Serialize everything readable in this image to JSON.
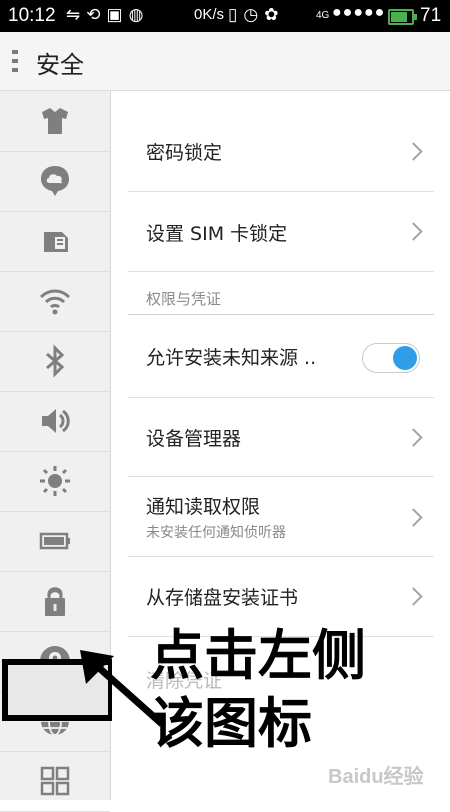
{
  "status_bar": {
    "time": "10:12",
    "speed": "0K/s",
    "network": "4G",
    "battery_level": "71",
    "icons": [
      "usb-icon",
      "sync-icon",
      "image-icon",
      "weibo-icon",
      "vibrate-icon",
      "alarm-icon",
      "paw-icon",
      "signal-icon",
      "battery-icon"
    ]
  },
  "title_bar": {
    "title": "安全",
    "menu_icon": "menu-icon"
  },
  "sidebar": {
    "items": [
      {
        "name": "theme-icon"
      },
      {
        "name": "cloud-icon"
      },
      {
        "name": "sim-card-icon"
      },
      {
        "name": "wifi-icon"
      },
      {
        "name": "bluetooth-icon"
      },
      {
        "name": "volume-icon"
      },
      {
        "name": "brightness-icon"
      },
      {
        "name": "battery-icon"
      },
      {
        "name": "lock-icon",
        "selected": true
      },
      {
        "name": "location-icon"
      },
      {
        "name": "globe-icon"
      },
      {
        "name": "apps-grid-icon"
      }
    ]
  },
  "settings": {
    "password_lock": "密码锁定",
    "sim_lock": "设置 SIM 卡锁定",
    "section_permissions": "权限与凭证",
    "unknown_sources": "允许安装未知来源 ..",
    "unknown_sources_enabled": true,
    "device_admin": "设备管理器",
    "notification_access": "通知读取权限",
    "notification_access_sub": "未安装任何通知侦听器",
    "install_from_storage": "从存储盘安装证书",
    "clear_credentials": "清除凭证"
  },
  "annotation": {
    "line1": "点击左侧",
    "line2": "该图标"
  },
  "watermark": "Baidu经验",
  "colors": {
    "accent": "#2f9de8",
    "status_bar": "#000000",
    "battery": "#4caf50"
  }
}
